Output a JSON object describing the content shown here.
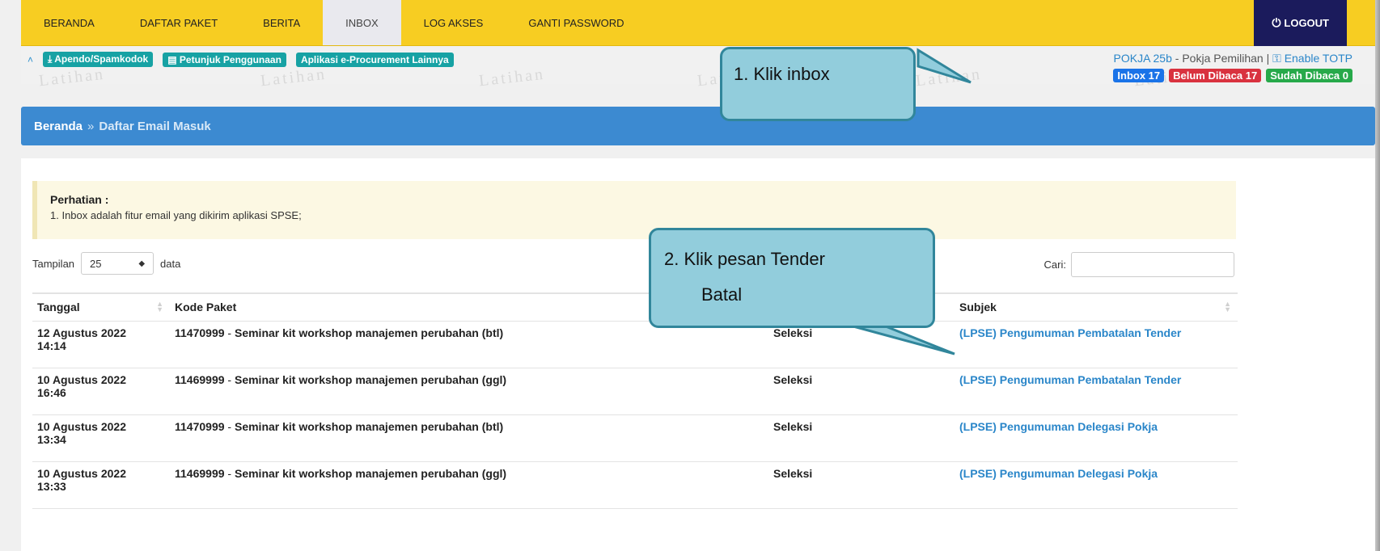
{
  "nav": {
    "items": [
      "BERANDA",
      "DAFTAR PAKET",
      "BERITA",
      "INBOX",
      "LOG AKSES",
      "GANTI PASSWORD"
    ],
    "active_index": 3,
    "logout_label": "LOGOUT"
  },
  "subbar": {
    "links": [
      "Apendo/Spamkodok",
      "Petunjuk Penggunaan",
      "Aplikasi e-Procurement Lainnya"
    ],
    "user_name": "POKJA 25b",
    "user_role": " - Pokja Pemilihan | ",
    "totp_label": "Enable TOTP",
    "badges": {
      "inbox": "Inbox 17",
      "unread": "Belum Dibaca 17",
      "read": "Sudah Dibaca 0"
    },
    "watermark": "Latihan"
  },
  "breadcrumb": {
    "home": "Beranda",
    "separator": "»",
    "current": "Daftar Email Masuk"
  },
  "alert": {
    "title": "Perhatian :",
    "text": "1. Inbox adalah fitur email yang dikirim aplikasi SPSE;"
  },
  "table_controls": {
    "show_label": "Tampilan",
    "page_size": "25",
    "data_label": "data",
    "search_label": "Cari:"
  },
  "table": {
    "headers": [
      "Tanggal",
      "Kode Paket",
      "",
      "Subjek"
    ],
    "rows": [
      {
        "date": "12 Agustus 2022",
        "time": "14:14",
        "code": "11470999",
        "name": "Seminar kit workshop manajemen perubahan (btl)",
        "type": "Seleksi",
        "subject": "(LPSE) Pengumuman Pembatalan Tender"
      },
      {
        "date": "10 Agustus 2022",
        "time": "16:46",
        "code": "11469999",
        "name": "Seminar kit workshop manajemen perubahan (ggl)",
        "type": "Seleksi",
        "subject": "(LPSE) Pengumuman Pembatalan Tender"
      },
      {
        "date": "10 Agustus 2022",
        "time": "13:34",
        "code": "11470999",
        "name": "Seminar kit workshop manajemen perubahan (btl)",
        "type": "Seleksi",
        "subject": "(LPSE) Pengumuman Delegasi Pokja"
      },
      {
        "date": "10 Agustus 2022",
        "time": "13:33",
        "code": "11469999",
        "name": "Seminar kit workshop manajemen perubahan (ggl)",
        "type": "Seleksi",
        "subject": "(LPSE) Pengumuman Delegasi Pokja"
      }
    ]
  },
  "callouts": {
    "one": "1.  Klik inbox",
    "two_line1": "2.  Klik pesan Tender",
    "two_line2": "Batal"
  },
  "colors": {
    "nav_bg": "#f7cd22",
    "logout_bg": "#1b1b5c",
    "breadcrumb_bg": "#3c8ad1",
    "callout_fill": "#92cddc",
    "callout_border": "#31869b"
  }
}
